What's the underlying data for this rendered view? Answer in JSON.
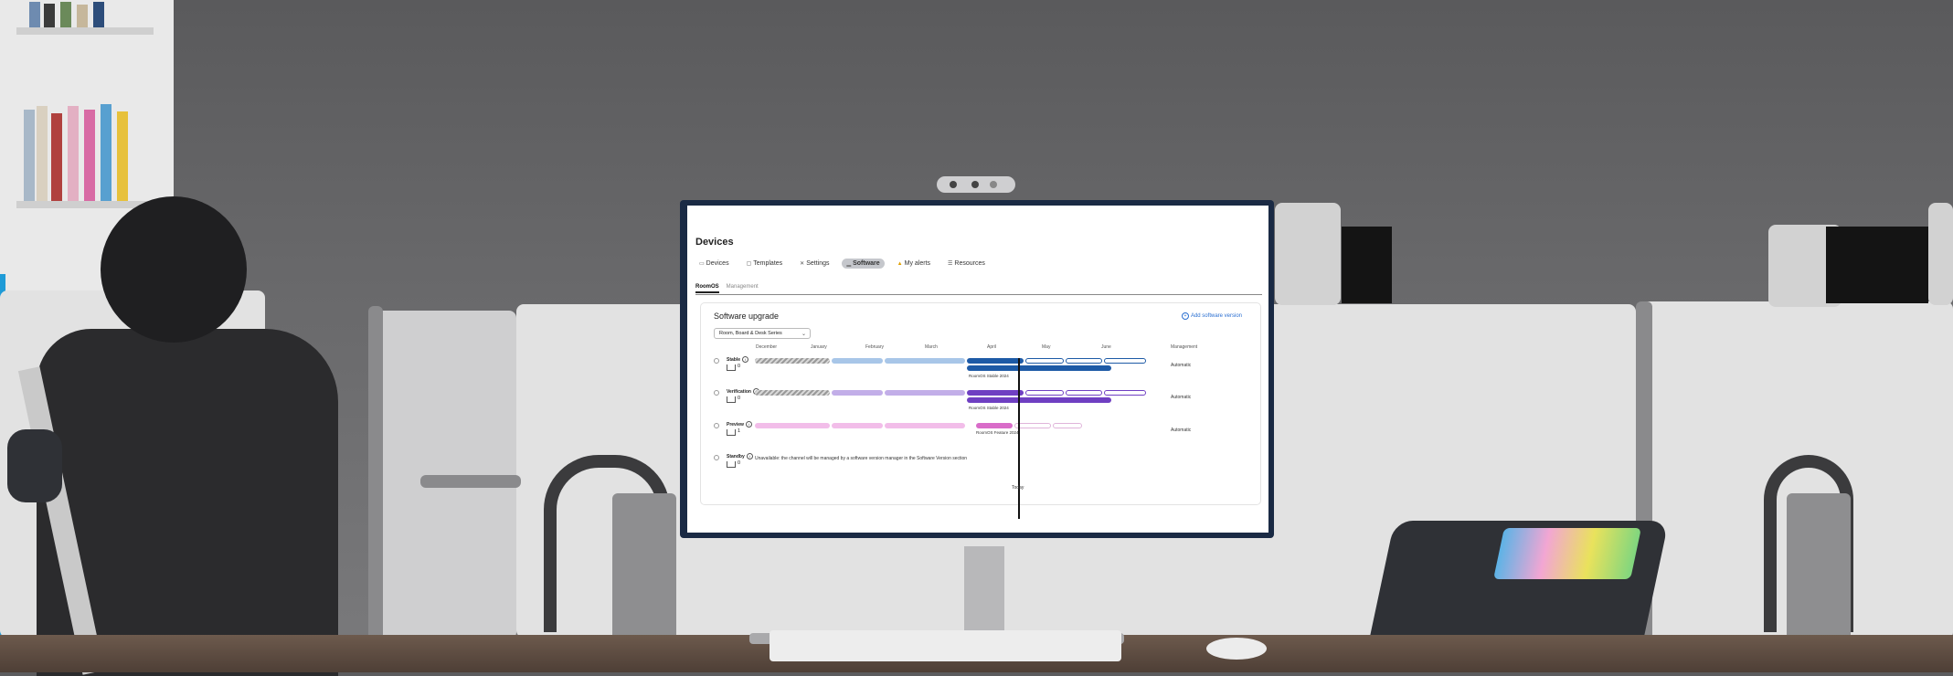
{
  "app": {
    "title": "Devices"
  },
  "tabs": [
    {
      "label": "Devices",
      "icon": "devices-icon",
      "active": false
    },
    {
      "label": "Templates",
      "icon": "templates-icon",
      "active": false
    },
    {
      "label": "Settings",
      "icon": "settings-icon",
      "active": false
    },
    {
      "label": "Software",
      "icon": "software-icon",
      "active": true
    },
    {
      "label": "My alerts",
      "icon": "alerts-icon",
      "active": false
    },
    {
      "label": "Resources",
      "icon": "resources-icon",
      "active": false
    }
  ],
  "subtabs": [
    {
      "label": "RoomOS",
      "active": true
    },
    {
      "label": "Management",
      "active": false
    }
  ],
  "software_upgrade": {
    "title": "Software upgrade",
    "add_link": "Add software version",
    "filter_value": "Room, Board & Desk Series",
    "months": [
      "December",
      "January",
      "February",
      "March",
      "April",
      "May",
      "June"
    ],
    "management_header": "Management",
    "today_label": "Today",
    "channels": [
      {
        "name": "Stable",
        "count": "0",
        "mode": "Automatic",
        "version_label": "RoomOS Stable 2024"
      },
      {
        "name": "Verification",
        "count": "0",
        "mode": "Automatic",
        "version_label": "RoomOS Stable 2024"
      },
      {
        "name": "Preview",
        "count": "1",
        "mode": "Automatic",
        "version_label": "RoomOS Feature 2024"
      },
      {
        "name": "Standby",
        "count": "0",
        "note": "Unavailable: the channel will be managed by a software version manager in the Software  Version section"
      }
    ]
  },
  "colors": {
    "stable": "#1d5aa6",
    "stable_light": "#a8c6e8",
    "verification": "#6f3fc2",
    "verification_light": "#c2aee8",
    "preview": "#d96cc9",
    "preview_light": "#f2bde9"
  }
}
